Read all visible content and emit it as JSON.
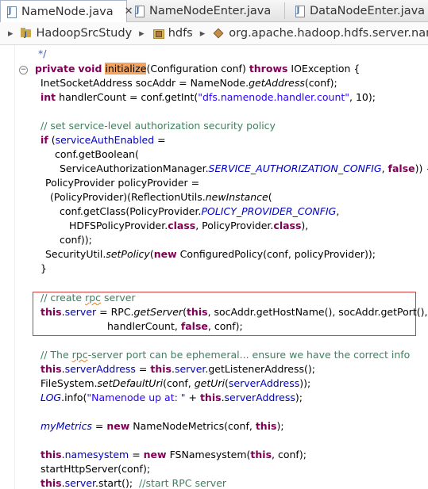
{
  "tabs": [
    {
      "label": "NameNode.java",
      "active": true,
      "close": "✕"
    },
    {
      "label": "NameNodeEnter.java",
      "active": false
    },
    {
      "label": "DataNodeEnter.java",
      "active": false
    }
  ],
  "breadcrumb": {
    "project": "HadoopSrcStudy",
    "folder": "hdfs",
    "package": "org.apache.hadoop.hdfs.server.name"
  },
  "code": {
    "l1_comment_end": "*/",
    "l2_private": "private",
    "l2_void": "void",
    "l2_method": "initialize",
    "l2_params": "(Configuration conf) ",
    "l2_throws": "throws",
    "l2_exc": " IOException {",
    "l3": "InetSocketAddress socAddr = NameNode.",
    "l3_m": "getAddress",
    "l3_end": "(conf);",
    "l4_int": "int",
    "l4_a": " handlerCount = conf.getInt(",
    "l4_str": "\"dfs.namenode.handler.count\"",
    "l4_end": ", 10);",
    "l6_comment": "// set service-level authorization security policy",
    "l7_if": "if",
    "l7_a": " (",
    "l7_fld": "serviceAuthEnabled",
    "l7_end": " =",
    "l8": "conf.getBoolean(",
    "l9_a": "ServiceAuthorizationManager.",
    "l9_sf": "SERVICE_AUTHORIZATION_CONFIG",
    "l9_b": ", ",
    "l9_false": "false",
    "l9_end": ")) {",
    "l10": "PolicyProvider policyProvider =",
    "l11_a": "(PolicyProvider)(ReflectionUtils.",
    "l11_m": "newInstance",
    "l11_end": "(",
    "l12_a": "conf.getClass(PolicyProvider.",
    "l12_sf": "POLICY_PROVIDER_CONFIG",
    "l12_end": ",",
    "l13_a": "HDFSPolicyProvider.",
    "l13_class1": "class",
    "l13_b": ", PolicyProvider.",
    "l13_class2": "class",
    "l13_end": "),",
    "l14": "conf));",
    "l15_a": "SecurityUtil.",
    "l15_m": "setPolicy",
    "l15_b": "(",
    "l15_new": "new",
    "l15_end": " ConfiguredPolicy(conf, policyProvider));",
    "l16": "}",
    "l18_comment_a": "// create ",
    "l18_comment_rpc": "rpc",
    "l18_comment_b": " server",
    "l19_this": "this",
    "l19_dot": ".",
    "l19_fld": "server",
    "l19_a": " = RPC.",
    "l19_m": "getServer",
    "l19_b": "(",
    "l19_this2": "this",
    "l19_end": ", socAddr.getHostName(), socAddr.getPort(),",
    "l20_a": "handlerCount, ",
    "l20_false": "false",
    "l20_end": ", conf);",
    "l22_comment_a": "// The ",
    "l22_comment_rpc": "rpc",
    "l22_comment_b": "-server port can be ephemeral... ensure we have the correct info",
    "l23_this": "this",
    "l23_fld": "serverAddress",
    "l23_a": " = ",
    "l23_this2": "this",
    "l23_fld2": "server",
    "l23_end": ".getListenerAddress();",
    "l24_a": "FileSystem.",
    "l24_m": "setDefaultUri",
    "l24_b": "(conf, ",
    "l24_m2": "getUri",
    "l24_c": "(",
    "l24_fld": "serverAddress",
    "l24_end": "));",
    "l25_sf": "LOG",
    "l25_a": ".info(",
    "l25_str": "\"Namenode up at: \"",
    "l25_b": " + ",
    "l25_this": "this",
    "l25_fld": "serverAddress",
    "l25_end": ");",
    "l27_sf": "myMetrics",
    "l27_a": " = ",
    "l27_new": "new",
    "l27_b": " NameNodeMetrics(conf, ",
    "l27_this": "this",
    "l27_end": ");",
    "l29_this": "this",
    "l29_fld": "namesystem",
    "l29_a": " = ",
    "l29_new": "new",
    "l29_b": " FSNamesystem(",
    "l29_this2": "this",
    "l29_end": ", conf);",
    "l30": "startHttpServer(conf);",
    "l31_this": "this",
    "l31_fld": "server",
    "l31_a": ".start();  ",
    "l31_comment": "//start RPC server"
  }
}
